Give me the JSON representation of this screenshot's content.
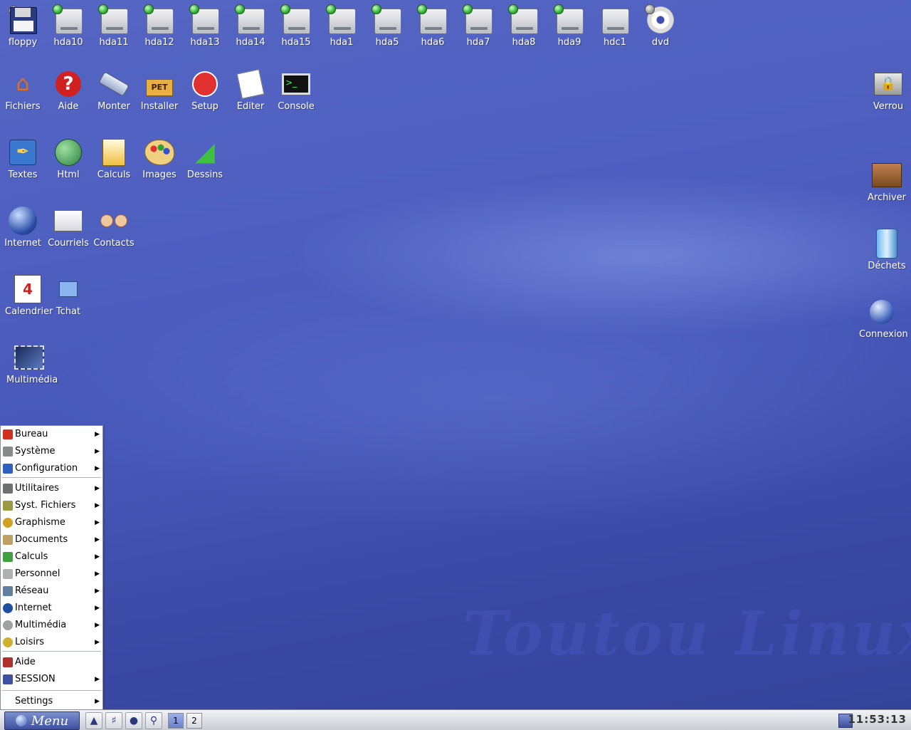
{
  "desktop": {
    "watermark": "Toutou Linux",
    "drives": [
      {
        "label": "floppy"
      },
      {
        "label": "hda10"
      },
      {
        "label": "hda11"
      },
      {
        "label": "hda12"
      },
      {
        "label": "hda13"
      },
      {
        "label": "hda14"
      },
      {
        "label": "hda15"
      },
      {
        "label": "hda1"
      },
      {
        "label": "hda5"
      },
      {
        "label": "hda6"
      },
      {
        "label": "hda7"
      },
      {
        "label": "hda8"
      },
      {
        "label": "hda9"
      },
      {
        "label": "hdc1"
      },
      {
        "label": "dvd"
      }
    ],
    "row2": [
      {
        "label": "Fichiers"
      },
      {
        "label": "Aide"
      },
      {
        "label": "Monter"
      },
      {
        "label": "Installer"
      },
      {
        "label": "Setup"
      },
      {
        "label": "Editer"
      },
      {
        "label": "Console"
      }
    ],
    "row3": [
      {
        "label": "Textes"
      },
      {
        "label": "Html"
      },
      {
        "label": "Calculs"
      },
      {
        "label": "Images"
      },
      {
        "label": "Dessins"
      }
    ],
    "row4": [
      {
        "label": "Internet"
      },
      {
        "label": "Courriels"
      },
      {
        "label": "Contacts"
      }
    ],
    "row5": [
      {
        "label": "Calendrier"
      },
      {
        "label": "Tchat"
      }
    ],
    "row6": [
      {
        "label": "Multimédia"
      }
    ],
    "right": [
      {
        "label": "Verrou"
      },
      {
        "label": "Archiver"
      },
      {
        "label": "Déchets"
      },
      {
        "label": "Connexion"
      }
    ]
  },
  "menu": {
    "items": [
      {
        "label": "Bureau",
        "submenu": true,
        "color": "#d03020"
      },
      {
        "label": "Système",
        "submenu": true,
        "color": "#8a8a8a"
      },
      {
        "label": "Configuration",
        "submenu": true,
        "color": "#3060c0"
      },
      {
        "label": "Utilitaires",
        "submenu": true,
        "color": "#707070"
      },
      {
        "label": "Syst. Fichiers",
        "submenu": true,
        "color": "#9a9a40"
      },
      {
        "label": "Graphisme",
        "submenu": true,
        "color": "#d0a020"
      },
      {
        "label": "Documents",
        "submenu": true,
        "color": "#c0a060"
      },
      {
        "label": "Calculs",
        "submenu": true,
        "color": "#40a040"
      },
      {
        "label": "Personnel",
        "submenu": true,
        "color": "#b0b0b0"
      },
      {
        "label": "Réseau",
        "submenu": true,
        "color": "#6080a0"
      },
      {
        "label": "Internet",
        "submenu": true,
        "color": "#2050a0"
      },
      {
        "label": "Multimédia",
        "submenu": true,
        "color": "#a0a0a0"
      },
      {
        "label": "Loisirs",
        "submenu": true,
        "color": "#d0b030"
      },
      {
        "label": "Aide",
        "submenu": false,
        "color": "#b03030"
      },
      {
        "label": "SESSION",
        "submenu": true,
        "color": "#4050a0"
      },
      {
        "label": "Settings",
        "submenu": true,
        "color": ""
      }
    ]
  },
  "taskbar": {
    "menu_label": "Menu",
    "desktops": [
      "1",
      "2"
    ],
    "clock": "11:53:13"
  }
}
